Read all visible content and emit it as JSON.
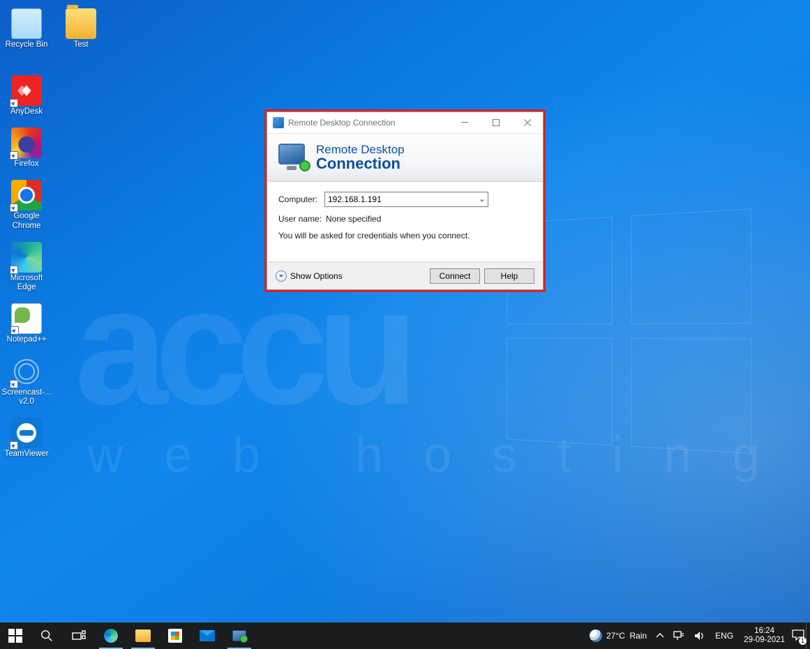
{
  "desktop_icons": [
    {
      "id": "recycle-bin",
      "label": "Recycle Bin"
    },
    {
      "id": "test-folder",
      "label": "Test"
    },
    {
      "id": "anydesk",
      "label": "AnyDesk"
    },
    {
      "id": "firefox",
      "label": "Firefox"
    },
    {
      "id": "google-chrome",
      "label": "Google\nChrome"
    },
    {
      "id": "microsoft-edge",
      "label": "Microsoft\nEdge"
    },
    {
      "id": "notepadpp",
      "label": "Notepad++"
    },
    {
      "id": "screencast",
      "label": "Screencast-...\nv2.0"
    },
    {
      "id": "teamviewer",
      "label": "TeamViewer"
    }
  ],
  "rdc": {
    "window_title": "Remote Desktop Connection",
    "banner_line1": "Remote Desktop",
    "banner_line2": "Connection",
    "computer_label": "Computer:",
    "computer_value": "192.168.1.191",
    "username_label": "User name:",
    "username_value": "None specified",
    "hint": "You will be asked for credentials when you connect.",
    "show_options": "Show Options",
    "connect": "Connect",
    "help": "Help"
  },
  "taskbar": {
    "weather_temp": "27°C",
    "weather_cond": "Rain",
    "lang": "ENG",
    "time": "16:24",
    "date": "29-09-2021",
    "notif_count": "1"
  },
  "watermark": {
    "top": "accu",
    "bottom": "web hosting"
  }
}
